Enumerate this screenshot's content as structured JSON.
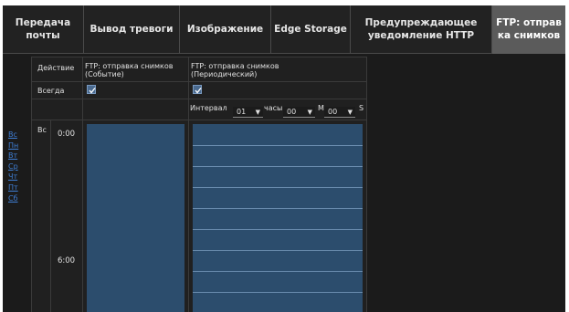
{
  "tabs": [
    {
      "label": "Передача почты",
      "active": false
    },
    {
      "label": "Вывод тревоги",
      "active": false
    },
    {
      "label": "Изображение",
      "active": false
    },
    {
      "label": "Edge Storage",
      "active": false
    },
    {
      "label": "Предупреждающее\nуведомление HTTP",
      "active": false
    },
    {
      "label": "FTP: отправ\nка снимков",
      "active": true
    }
  ],
  "days": [
    "Вс",
    "Пн",
    "Вт",
    "Ср",
    "Чт",
    "Пт",
    "Сб"
  ],
  "table": {
    "action_label": "Действие",
    "always_label": "Всегда",
    "col1_header": "FTP: отправка снимков\n(Событие)",
    "col2_header": "FTP: отправка снимков\n(Периодический)",
    "col1_always_checked": true,
    "col2_always_checked": true,
    "interval_label": "Интервал",
    "hours_value": "01",
    "hours_unit": "часы",
    "minutes_value": "00",
    "minutes_unit": "М",
    "seconds_value": "00",
    "seconds_unit": "S",
    "current_day": "Вс",
    "time_0": "0:00",
    "time_6": "6:00"
  },
  "colors": {
    "background": "#1b1b1b",
    "tab_active": "#5b5b5b",
    "link": "#3f7fd6",
    "schedule_fill": "#2c4d6d",
    "schedule_line": "#6a8cae"
  }
}
